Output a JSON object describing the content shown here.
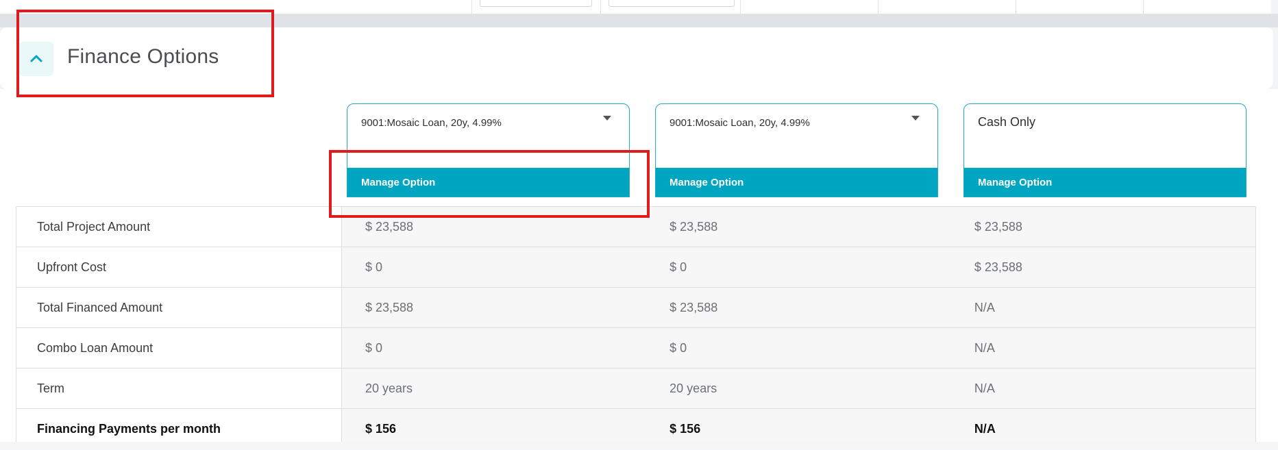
{
  "section": {
    "title": "Finance Options",
    "collapse_icon": "chevron-up-icon"
  },
  "options": [
    {
      "selected": "9001:Mosaic Loan, 20y, 4.99%",
      "manage_label": "Manage Option"
    },
    {
      "selected": "9001:Mosaic Loan, 20y, 4.99%",
      "manage_label": "Manage Option"
    },
    {
      "selected": "Cash Only",
      "manage_label": "Manage Option"
    }
  ],
  "rows": [
    {
      "label": "Total Project Amount",
      "values": [
        "$ 23,588",
        "$ 23,588",
        "$ 23,588"
      ]
    },
    {
      "label": "Upfront Cost",
      "values": [
        "$ 0",
        "$ 0",
        "$ 23,588"
      ]
    },
    {
      "label": "Total Financed Amount",
      "values": [
        "$ 23,588",
        "$ 23,588",
        "N/A"
      ]
    },
    {
      "label": "Combo Loan Amount",
      "values": [
        "$ 0",
        "$ 0",
        "N/A"
      ]
    },
    {
      "label": "Term",
      "values": [
        "20 years",
        "20 years",
        "N/A"
      ]
    },
    {
      "label": "Financing Payments per month",
      "values": [
        "$ 156",
        "$ 156",
        "N/A"
      ]
    }
  ],
  "colors": {
    "accent": "#00a6c1",
    "annotation": "#e01b1b"
  }
}
